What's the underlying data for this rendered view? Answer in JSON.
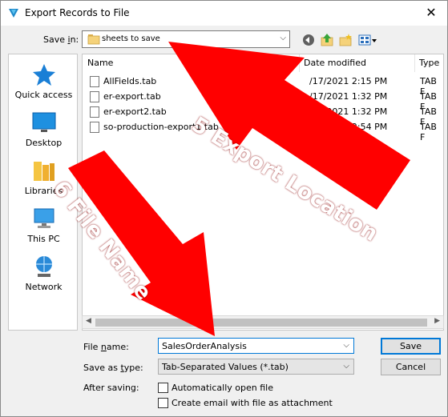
{
  "dialog": {
    "title": "Export Records to File",
    "close_glyph": "✕"
  },
  "toolbar": {
    "save_in_label_pre": "Save ",
    "save_in_label_u": "i",
    "save_in_label_post": "n:",
    "save_in_value": "sheets to save",
    "icons": [
      "back-icon",
      "up-folder-icon",
      "new-folder-icon",
      "view-menu-icon"
    ]
  },
  "places": [
    {
      "label": "Quick access",
      "icon": "quick-access-icon"
    },
    {
      "label": "Desktop",
      "icon": "desktop-icon"
    },
    {
      "label": "Libraries",
      "icon": "libraries-icon"
    },
    {
      "label": "This PC",
      "icon": "this-pc-icon"
    },
    {
      "label": "Network",
      "icon": "network-icon"
    }
  ],
  "filelist": {
    "columns": {
      "name": "Name",
      "date": "Date modified",
      "type": "Type"
    },
    "rows": [
      {
        "name": "AllFields.tab",
        "date": "/17/2021 2:15 PM",
        "type": "TAB F"
      },
      {
        "name": "er-export.tab",
        "date": "/17/2021 1:32 PM",
        "type": "TAB F"
      },
      {
        "name": "er-export2.tab",
        "date": "/17/2021 1:32 PM",
        "type": "TAB F"
      },
      {
        "name": "so-production-export1.tab",
        "date": "/17/2021 2:54 PM",
        "type": "TAB F"
      }
    ]
  },
  "form": {
    "file_name_label_pre": "File ",
    "file_name_label_u": "n",
    "file_name_label_post": "ame:",
    "file_name_value": "SalesOrderAnalysis",
    "save_type_label_pre": "Save as ",
    "save_type_label_u": "t",
    "save_type_label_post": "ype:",
    "save_type_value": "Tab-Separated Values (*.tab)",
    "after_saving_label": "After saving:",
    "auto_open_label": "Automatically open file",
    "auto_open_checked": false,
    "create_email_label": "Create email with file as attachment",
    "create_email_checked": false
  },
  "buttons": {
    "save": "Save",
    "cancel": "Cancel"
  },
  "annotations": {
    "export_location": "5 Export Location",
    "file_name": "6 File Name",
    "arrow_color": "#ff0000"
  }
}
